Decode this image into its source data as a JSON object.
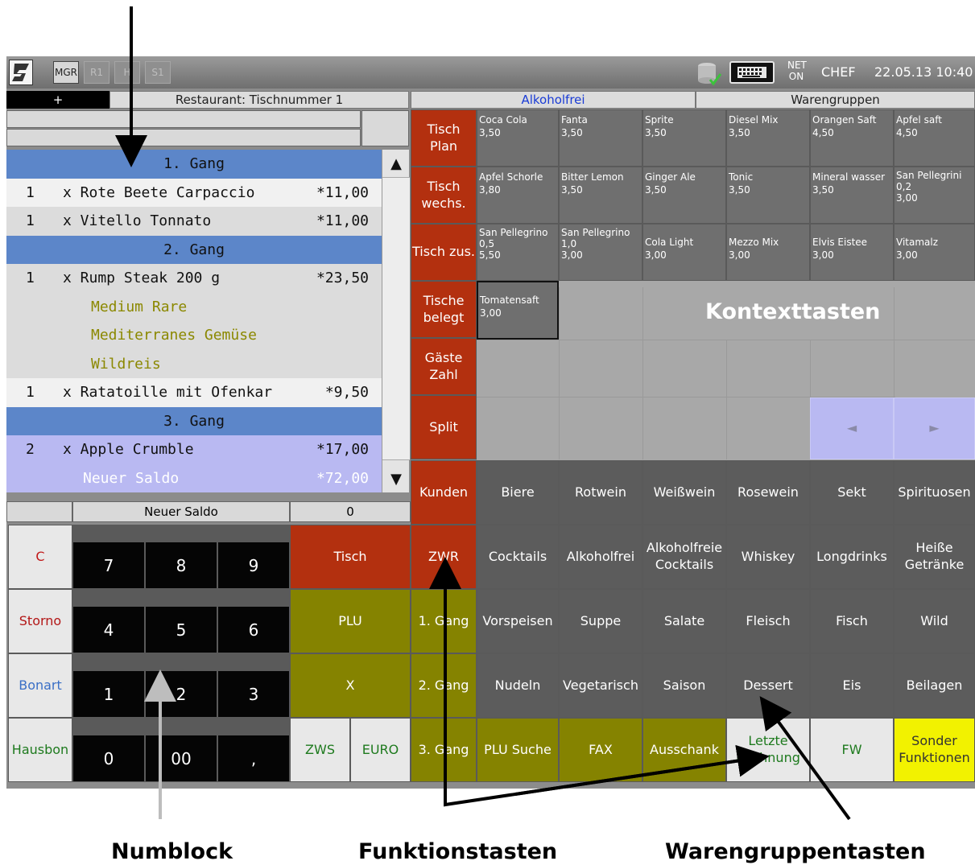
{
  "topbar": {
    "modes": [
      "MGR",
      "R1",
      "H",
      "S1"
    ],
    "net": "NET",
    "on": "ON",
    "user": "CHEF",
    "datetime": "22.05.13 10:40"
  },
  "header": {
    "plus": "+",
    "table": "Restaurant: Tischnummer 1",
    "category": "Alkoholfrei",
    "groups": "Warengruppen"
  },
  "order": {
    "course1": "1. Gang",
    "item1": {
      "qty": "1",
      "name": "x Rote Beete Carpaccio",
      "price": "*11,00"
    },
    "item2": {
      "qty": "1",
      "name": "x Vitello Tonnato",
      "price": "*11,00"
    },
    "course2": "2. Gang",
    "item3": {
      "qty": "1",
      "name": "x Rump Steak 200 g",
      "price": "*23,50"
    },
    "opt1": "Medium Rare",
    "opt2": "Mediterranes Gemüse",
    "opt3": "Wildreis",
    "item4": {
      "qty": "1",
      "name": "x Ratatoille mit Ofenkar",
      "price": "*9,50"
    },
    "course3": "3. Gang",
    "item5": {
      "qty": "2",
      "name": "x Apple Crumble",
      "price": "*17,00"
    },
    "saldo_label": "Neuer Saldo",
    "saldo_value": "*72,00"
  },
  "scroll": {
    "up": "▲",
    "down": "▼"
  },
  "balance": {
    "label": "Neuer Saldo",
    "value": "0"
  },
  "numpad": {
    "c": "C",
    "storno": "Storno",
    "bonart": "Bonart",
    "hausbon": "Hausbon",
    "n7": "7",
    "n8": "8",
    "n9": "9",
    "n4": "4",
    "n5": "5",
    "n6": "6",
    "n1": "1",
    "n2": "2",
    "n3": "3",
    "n0": "0",
    "n00": "00",
    "comma": ","
  },
  "actions": {
    "tisch": "Tisch",
    "plu": "PLU",
    "x": "X",
    "zws": "ZWS",
    "euro": "EURO"
  },
  "functions": {
    "f1": "Tisch Plan",
    "f2": "Tisch wechs.",
    "f3": "Tisch zus.",
    "f4": "Tische belegt",
    "f5": "Gäste Zahl",
    "f6": "Split",
    "f7": "Kunden",
    "f8": "ZWR",
    "f9": "1. Gang",
    "f10": "2. Gang",
    "f11": "3. Gang"
  },
  "products": [
    {
      "name": "Coca Cola",
      "price": "3,50"
    },
    {
      "name": "Fanta",
      "price": "3,50"
    },
    {
      "name": "Sprite",
      "price": "3,50"
    },
    {
      "name": "Diesel Mix",
      "price": "3,50"
    },
    {
      "name": "Orangen Saft",
      "price": "4,50"
    },
    {
      "name": "Apfel saft",
      "price": "4,50"
    },
    {
      "name": "Apfel Schorle",
      "price": "3,80"
    },
    {
      "name": "Bitter Lemon",
      "price": "3,50"
    },
    {
      "name": "Ginger Ale",
      "price": "3,50"
    },
    {
      "name": "Tonic",
      "price": "3,50"
    },
    {
      "name": "Mineral wasser",
      "price": "3,50"
    },
    {
      "name": "San Pellegrini",
      "size": "0,2",
      "price": "3,00"
    },
    {
      "name": "San Pellegrino",
      "size": "0,5",
      "price": "5,50"
    },
    {
      "name": "San Pellegrino",
      "size": "1,0",
      "price": "3,00"
    },
    {
      "name": "Cola Light",
      "price": "3,00"
    },
    {
      "name": "Mezzo Mix",
      "price": "3,00"
    },
    {
      "name": "Elvis Eistee",
      "price": "3,00"
    },
    {
      "name": "Vitamalz",
      "price": "3,00"
    },
    {
      "name": "Tomatensaft",
      "price": "3,00"
    }
  ],
  "context_label": "Kontexttasten",
  "nav": {
    "prev": "◄",
    "next": "►"
  },
  "groups": {
    "g1": "Biere",
    "g2": "Rotwein",
    "g3": "Weißwein",
    "g4": "Rosewein",
    "g5": "Sekt",
    "g6": "Spirituosen",
    "g7": "Cocktails",
    "g8": "Alkoholfrei",
    "g9": "Alkoholfreie Cocktails",
    "g10": "Whiskey",
    "g11": "Longdrinks",
    "g12": "Heiße Getränke",
    "g13": "Vorspeisen",
    "g14": "Suppe",
    "g15": "Salate",
    "g16": "Fleisch",
    "g17": "Fisch",
    "g18": "Wild",
    "g19": "Nudeln",
    "g20": "Vegetarisch",
    "g21": "Saison",
    "g22": "Dessert",
    "g23": "Eis",
    "g24": "Beilagen",
    "g25": "PLU Suche",
    "g26": "FAX",
    "g27": "Ausschank",
    "g28": "Letzte Rechnung",
    "g29": "FW",
    "g30": "Sonder Funktionen"
  },
  "annotations": {
    "numblock": "Numblock",
    "funktionstasten": "Funktionstasten",
    "warengruppentasten": "Warengruppentasten"
  },
  "colors": {
    "function_red": "#b3300f",
    "olive": "#858300",
    "course_blue": "#5c86c9",
    "lavender": "#b9b9f2",
    "special_yellow": "#f2f200"
  }
}
